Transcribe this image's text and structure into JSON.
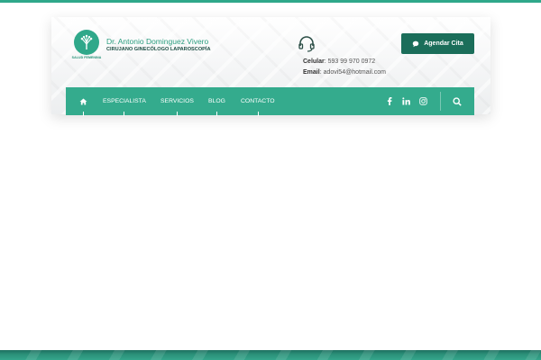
{
  "brand": {
    "logo_caption": "SALUD FEMENINA",
    "name": "Dr. Antonio Dominguez Vivero",
    "subtitle": "CIRUJANO GINECÓLOGO LAPAROSCOPÍA"
  },
  "contact": {
    "phone_label": "Celular",
    "phone_value": ": 593 99 970 0972",
    "email_label": "Email",
    "email_value": ": adovi54@hotmail.com"
  },
  "cta": {
    "label": "Agendar Cita",
    "icon": "chat-icon"
  },
  "nav": {
    "home_icon": "home-icon",
    "items": [
      {
        "label": "ESPECIALISTA"
      },
      {
        "label": "SERVICIOS"
      },
      {
        "label": "BLOG"
      },
      {
        "label": "CONTACTO"
      }
    ],
    "social": [
      "facebook-icon",
      "linkedin-icon",
      "instagram-icon"
    ],
    "search_icon": "search-icon"
  },
  "colors": {
    "primary": "#34ab8d",
    "dark": "#1b6e5a",
    "text_accent": "#2a9d7f"
  }
}
